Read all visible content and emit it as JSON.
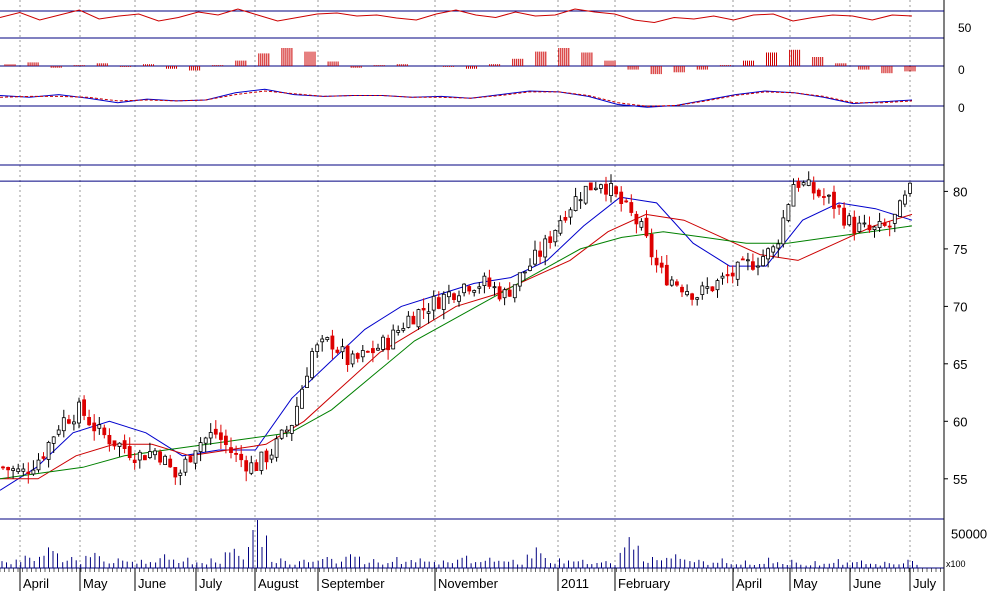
{
  "chart_data": [
    {
      "type": "line",
      "panel": "rsi",
      "ylim": [
        0,
        100
      ],
      "y_ticks": [
        50
      ],
      "reference_lines": [
        80,
        20
      ],
      "series": [
        {
          "values": [
            55,
            65,
            50,
            60,
            70,
            52,
            58,
            62,
            48,
            55,
            66,
            60,
            72,
            60,
            48,
            55,
            62,
            64,
            58,
            60,
            54,
            50,
            62,
            70,
            60,
            55,
            66,
            58,
            60,
            72,
            66,
            62,
            50,
            45,
            55,
            52,
            58,
            50,
            60,
            62,
            48,
            55,
            60,
            58,
            50,
            60,
            58
          ],
          "color": "#cc0000"
        }
      ]
    },
    {
      "type": "bar",
      "panel": "macd-histogram",
      "y_ticks": [
        0
      ],
      "series": [
        {
          "values": [
            0.2,
            0.4,
            -0.2,
            0.1,
            0.3,
            -0.1,
            0.2,
            -0.3,
            -0.5,
            0.1,
            0.6,
            1.4,
            2.0,
            1.6,
            0.5,
            -0.2,
            0.1,
            0.2,
            0.0,
            -0.1,
            -0.3,
            0.2,
            0.8,
            1.6,
            2.0,
            1.5,
            0.6,
            -0.4,
            -0.9,
            -0.7,
            -0.4,
            0.1,
            0.6,
            1.5,
            1.8,
            1.0,
            0.3,
            -0.4,
            -0.8,
            -0.6
          ],
          "color": "#cc0000"
        }
      ]
    },
    {
      "type": "line",
      "panel": "macd",
      "y_ticks": [
        0
      ],
      "series": [
        {
          "values": [
            0.5,
            0.3,
            0.6,
            0.2,
            -0.3,
            0.1,
            -0.1,
            0.0,
            0.8,
            1.2,
            0.6,
            0.4,
            0.5,
            0.5,
            0.3,
            0.4,
            0.2,
            0.6,
            1.0,
            0.9,
            0.4,
            -0.5,
            -0.8,
            -0.6,
            0.0,
            0.6,
            1.0,
            0.8,
            0.3,
            -0.4,
            -0.2,
            0.0
          ],
          "color": "#0000cc"
        },
        {
          "values": [
            0.3,
            0.4,
            0.4,
            0.3,
            -0.1,
            0.0,
            -0.1,
            0.0,
            0.6,
            1.0,
            0.7,
            0.4,
            0.5,
            0.5,
            0.3,
            0.3,
            0.2,
            0.5,
            0.9,
            0.9,
            0.5,
            -0.3,
            -0.7,
            -0.6,
            -0.1,
            0.5,
            0.9,
            0.8,
            0.4,
            -0.3,
            -0.3,
            -0.1
          ],
          "color": "#cc0000"
        }
      ]
    },
    {
      "type": "line",
      "panel": "price",
      "ylim": [
        51.5,
        82.3
      ],
      "y_ticks": [
        55,
        60,
        65,
        70,
        75,
        80
      ],
      "reference_line": 80.9,
      "candles_close": [
        56,
        55.5,
        57,
        60,
        61,
        59,
        58,
        57,
        57.5,
        55,
        58,
        59,
        57,
        56,
        57.5,
        60,
        66,
        67,
        65,
        66,
        67,
        69,
        70,
        71,
        72,
        72,
        71,
        73,
        75,
        78,
        80,
        81,
        79,
        77,
        73,
        72,
        71,
        72,
        73,
        74,
        75,
        81,
        80,
        79,
        77,
        76.5,
        77,
        80
      ],
      "series": [
        {
          "values": [
            54,
            56,
            59,
            60,
            59,
            57,
            57.5,
            57.5,
            62,
            65,
            68,
            70,
            71,
            72,
            72.5,
            74,
            77,
            79.5,
            79,
            75.5,
            73.5,
            73.5,
            77.5,
            79,
            78.5,
            77.5
          ],
          "color": "#0000cc"
        },
        {
          "values": [
            55,
            55,
            57,
            58,
            58,
            57,
            57.5,
            58,
            60,
            63,
            66,
            68,
            70,
            71,
            72.5,
            74,
            76.5,
            78,
            77.5,
            76,
            74.5,
            74,
            75.5,
            77,
            78
          ],
          "color": "#cc0000"
        },
        {
          "values": [
            55,
            55.5,
            56,
            57,
            57.5,
            58,
            58.5,
            59,
            61,
            64,
            67,
            69,
            71,
            73,
            75,
            76,
            76.5,
            76,
            75.5,
            75.5,
            76,
            76.5,
            77
          ],
          "color": "#008000"
        }
      ]
    },
    {
      "type": "bar",
      "panel": "volume",
      "y_ticks": [
        50000
      ],
      "scale_note": "x100",
      "series": [
        {
          "values": [
            10000,
            18000,
            30000,
            16000,
            22000,
            14000,
            12000,
            20000,
            15000,
            14000,
            28000,
            70000,
            14000,
            12000,
            16000,
            20000,
            13000,
            16000,
            14000,
            11000,
            18000,
            15000,
            12000,
            30000,
            14000,
            12000,
            10000,
            45000,
            16000,
            20000,
            12000,
            14000,
            11000,
            15000,
            12000,
            10000,
            13000,
            11000,
            9000,
            12000
          ],
          "color": "#000080"
        }
      ]
    },
    {
      "type": "line",
      "panel": "date-axis",
      "categories": [
        "April",
        "May",
        "June",
        "July",
        "August",
        "September",
        "November",
        "2011",
        "February",
        "April",
        "May",
        "June",
        "July"
      ]
    }
  ]
}
